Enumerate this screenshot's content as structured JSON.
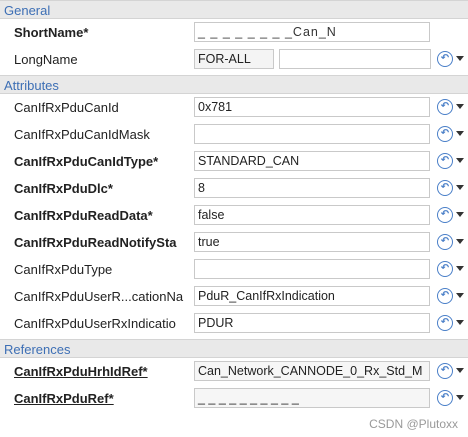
{
  "general": {
    "header": "General",
    "short_name": {
      "label": "ShortName*",
      "value": "_ _ _ _ _ _ _ _Can_N"
    },
    "long_name": {
      "label": "LongName",
      "lang": "FOR-ALL",
      "value": ""
    }
  },
  "attributes": {
    "header": "Attributes",
    "rows": [
      {
        "label": "CanIfRxPduCanId",
        "value": "0x781"
      },
      {
        "label": "CanIfRxPduCanIdMask",
        "value": ""
      },
      {
        "label": "CanIfRxPduCanIdType*",
        "value": "STANDARD_CAN"
      },
      {
        "label": "CanIfRxPduDlc*",
        "value": "8"
      },
      {
        "label": "CanIfRxPduReadData*",
        "value": "false"
      },
      {
        "label": "CanIfRxPduReadNotifySta",
        "value": "true"
      },
      {
        "label": "CanIfRxPduType",
        "value": ""
      },
      {
        "label": "CanIfRxPduUserR...cationNa",
        "value": "PduR_CanIfRxIndication"
      },
      {
        "label": "CanIfRxPduUserRxIndicatio",
        "value": "PDUR"
      }
    ]
  },
  "references": {
    "header": "References",
    "rows": [
      {
        "label": "CanIfRxPduHrhIdRef*",
        "value": "Can_Network_CANNODE_0_Rx_Std_M"
      },
      {
        "label": "CanIfRxPduRef*",
        "value": "_ _ _ _ _ _ _ _ _ _"
      }
    ]
  },
  "reset_icon": "reset-icon",
  "watermark": "CSDN @Plutoxx"
}
